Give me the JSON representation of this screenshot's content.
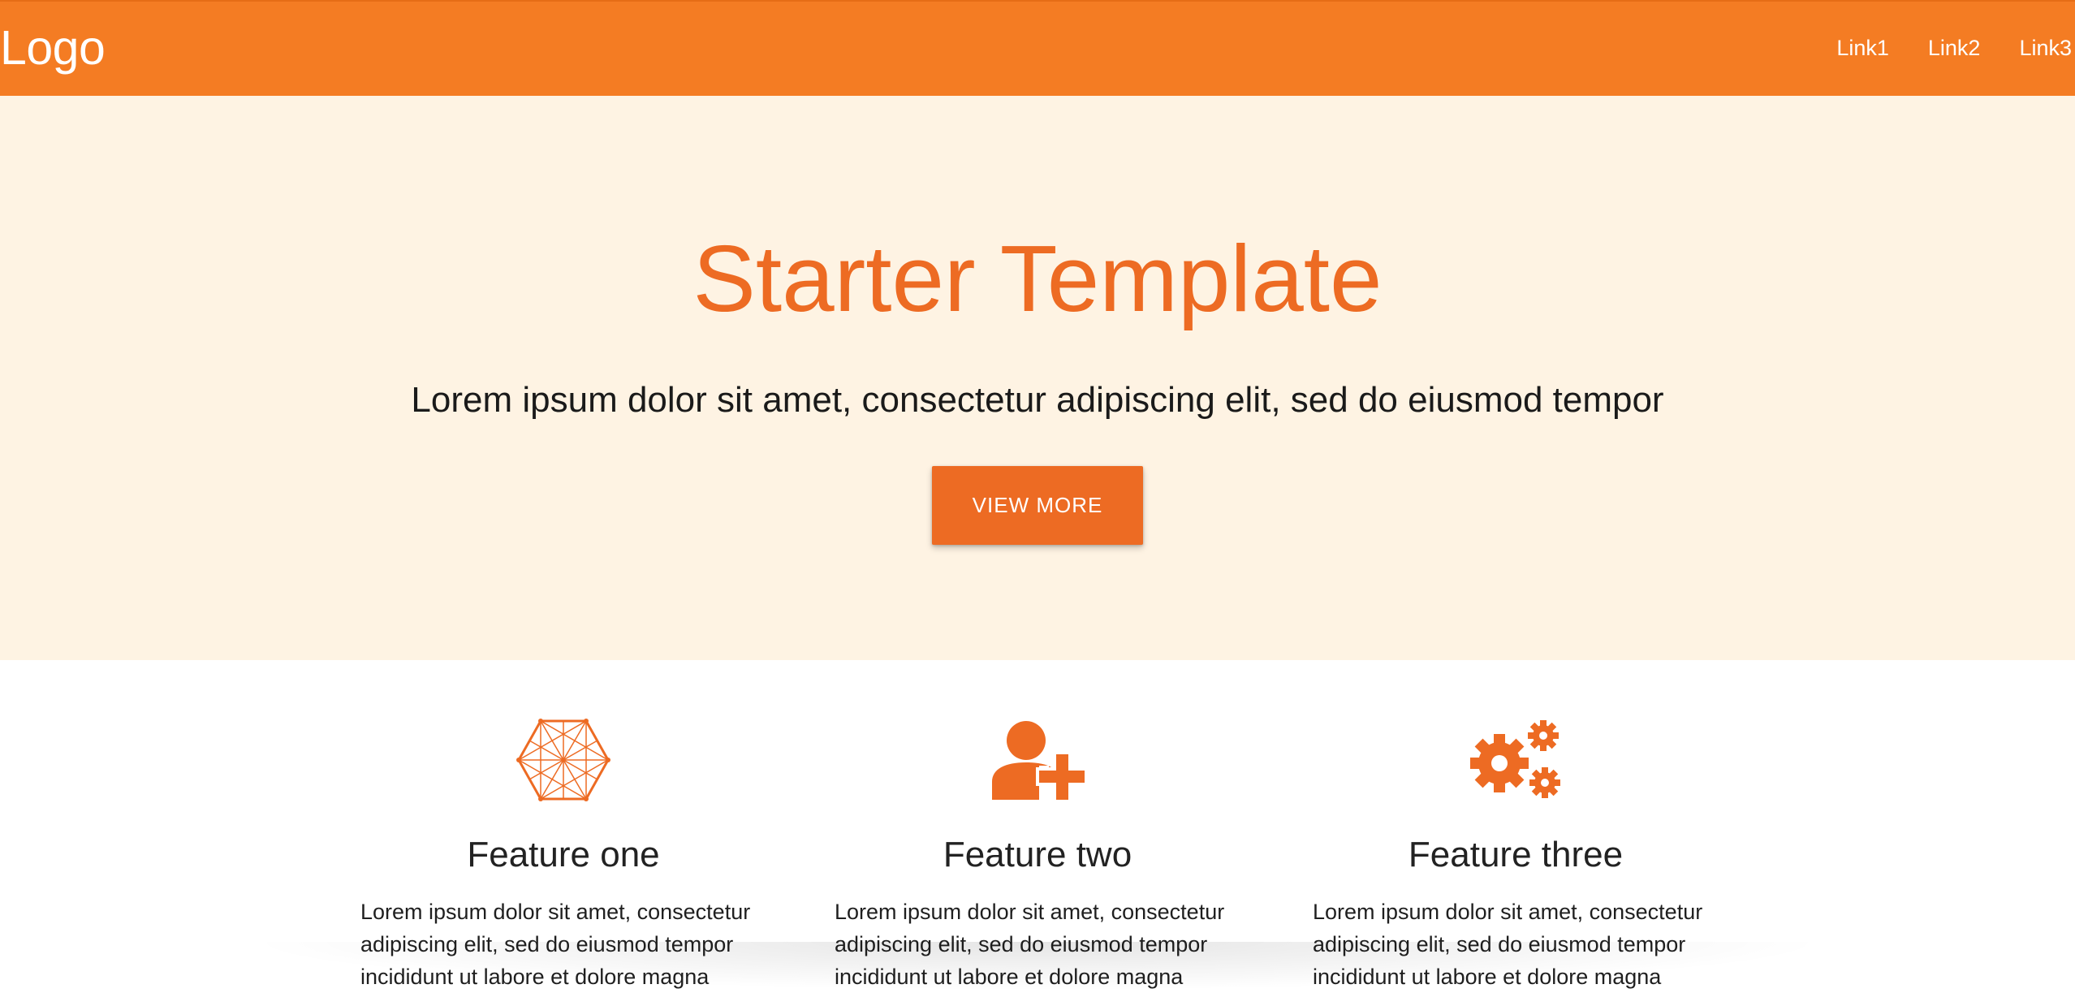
{
  "nav": {
    "logo": "Logo",
    "links": [
      "Link1",
      "Link2",
      "Link3"
    ],
    "background_color": "#f47c23"
  },
  "hero": {
    "title": "Starter Template",
    "subtitle": "Lorem ipsum dolor sit amet, consectetur adipiscing elit, sed do eiusmod tempor",
    "button_label": "VIEW MORE",
    "background_color": "#fef3e3",
    "accent_color": "#ed6b23"
  },
  "features": [
    {
      "icon": "network-hexagon-icon",
      "title": "Feature one",
      "text": "Lorem ipsum dolor sit amet, consectetur adipiscing elit, sed do eiusmod tempor incididunt ut labore et dolore magna"
    },
    {
      "icon": "add-user-icon",
      "title": "Feature two",
      "text": "Lorem ipsum dolor sit amet, consectetur adipiscing elit, sed do eiusmod tempor incididunt ut labore et dolore magna"
    },
    {
      "icon": "gears-icon",
      "title": "Feature three",
      "text": "Lorem ipsum dolor sit amet, consectetur adipiscing elit, sed do eiusmod tempor incididunt ut labore et dolore magna"
    }
  ]
}
